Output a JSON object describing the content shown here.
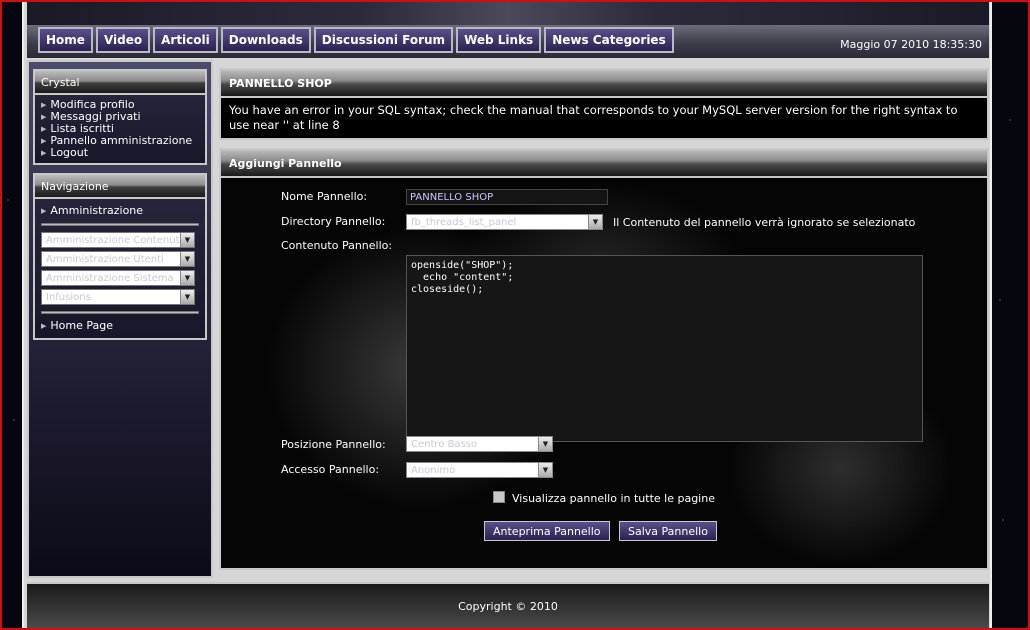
{
  "nav": {
    "items": [
      {
        "label": "Home"
      },
      {
        "label": "Video"
      },
      {
        "label": "Articoli"
      },
      {
        "label": "Downloads"
      },
      {
        "label": "Discussioni Forum"
      },
      {
        "label": "Web Links"
      },
      {
        "label": "News Categories"
      }
    ],
    "datetime": "Maggio 07 2010 18:35:30"
  },
  "sidebar": {
    "user_panel": {
      "title": "Crystal",
      "links": [
        {
          "label": "Modifica profilo"
        },
        {
          "label": "Messaggi privati"
        },
        {
          "label": "Lista iscritti"
        },
        {
          "label": "Pannello amministrazione"
        },
        {
          "label": "Logout"
        }
      ]
    },
    "nav_panel": {
      "title": "Navigazione",
      "top_link": "Amministrazione",
      "selects": [
        {
          "value": "Amministrazione Contenuti"
        },
        {
          "value": "Amministrazione Utenti"
        },
        {
          "value": "Amministrazione Sistema"
        },
        {
          "value": "Infusions"
        }
      ],
      "bottom_link": "Home Page"
    }
  },
  "error_box": {
    "title": "PANNELLO SHOP",
    "message": "You have an error in your SQL syntax; check the manual that corresponds to your MySQL server version for the right syntax to use near '' at line 8"
  },
  "form": {
    "title": "Aggiungi Pannello",
    "name_label": "Nome Pannello:",
    "name_value": "PANNELLO SHOP",
    "dir_label": "Directory Pannello:",
    "dir_value": "fb_threads_list_panel",
    "dir_note": "Il Contenuto del pannello verrà ignorato se selezionato",
    "content_label": "Contenuto Pannello:",
    "content_value": "openside(\"SHOP\");\n  echo \"content\";\ncloseside();",
    "position_label": "Posizione Pannello:",
    "position_value": "Centro Basso",
    "access_label": "Accesso Pannello:",
    "access_value": "Anonimo",
    "all_pages_label": "Visualizza pannello in tutte le pagine",
    "preview_button": "Anteprima Pannello",
    "save_button": "Salva Pannello"
  },
  "footer": {
    "copyright": "Copyright © 2010"
  }
}
